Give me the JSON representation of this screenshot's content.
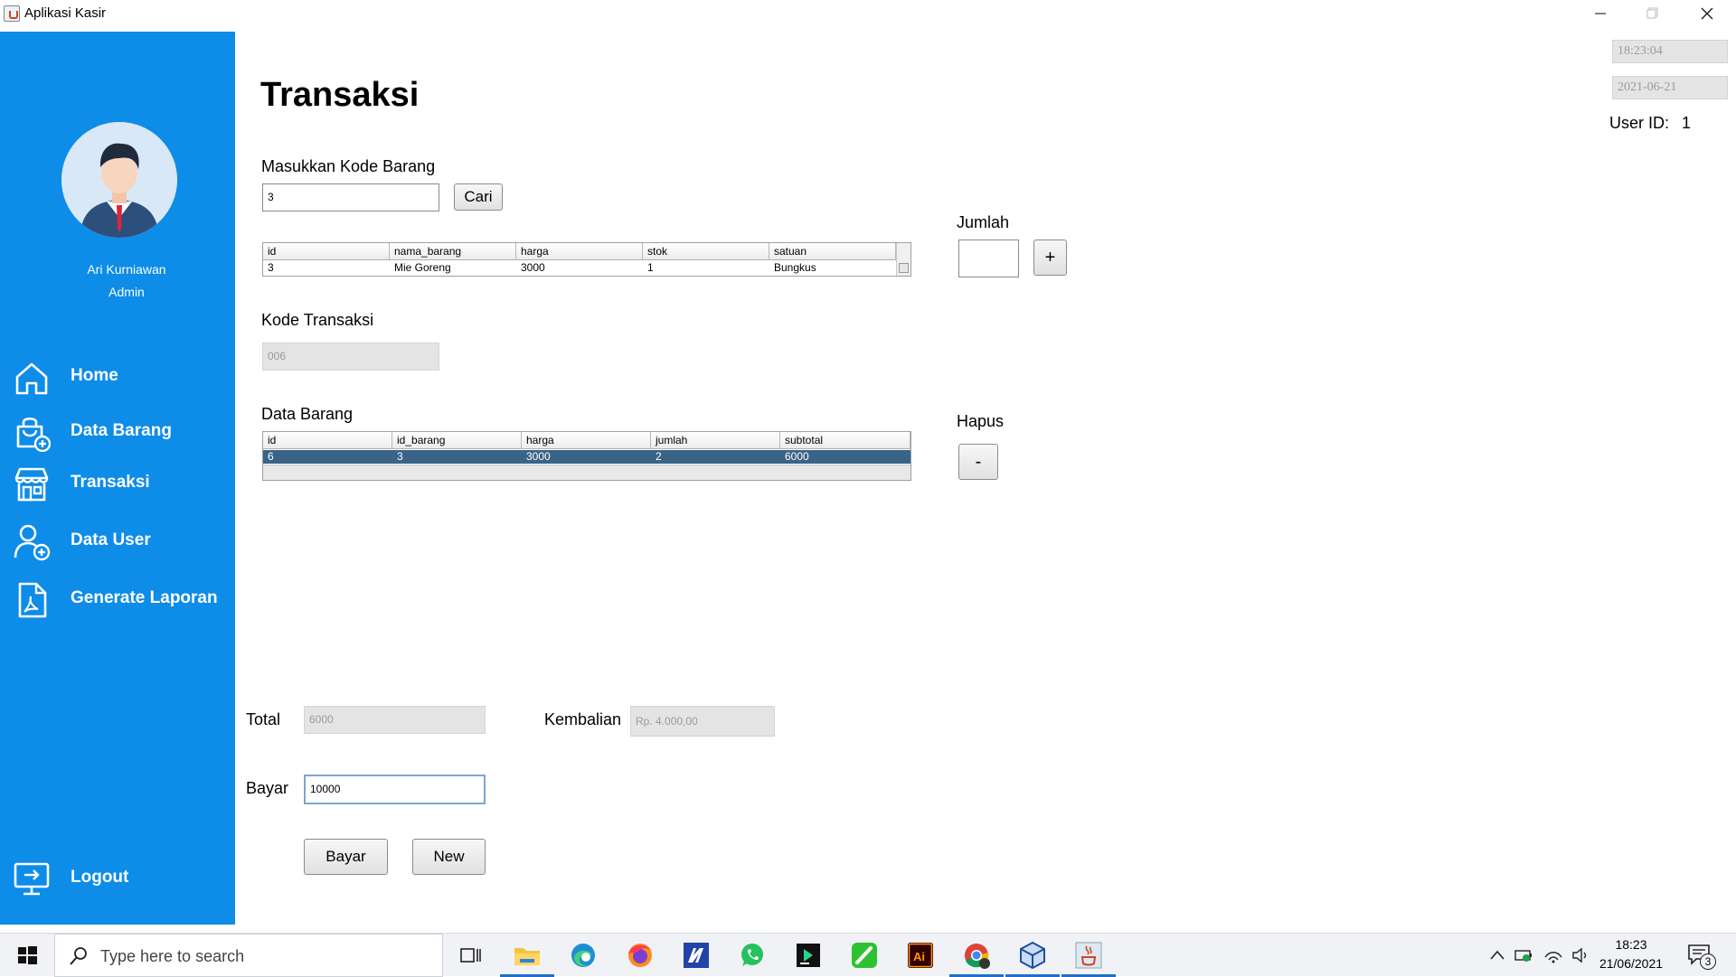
{
  "window": {
    "title": "Aplikasi Kasir"
  },
  "sidebar": {
    "user_name": "Ari Kurniawan",
    "user_role": "Admin",
    "items": [
      {
        "label": "Home",
        "icon": "home-icon"
      },
      {
        "label": "Data Barang",
        "icon": "bag-add-icon"
      },
      {
        "label": "Transaksi",
        "icon": "store-icon"
      },
      {
        "label": "Data User",
        "icon": "user-add-icon"
      },
      {
        "label": "Generate Laporan",
        "icon": "pdf-document-icon"
      }
    ],
    "logout_label": "Logout",
    "accent": "#0d8ce8"
  },
  "header": {
    "time": "18:23:04",
    "date": "2021-06-21",
    "user_id_label": "User ID:",
    "user_id_value": "1"
  },
  "main": {
    "title": "Transaksi",
    "kode_barang_label": "Masukkan Kode Barang",
    "kode_barang_value": "3",
    "cari_label": "Cari",
    "jumlah_label": "Jumlah",
    "jumlah_value": "",
    "add_label": "+",
    "search_table": {
      "columns": [
        "id",
        "nama_barang",
        "harga",
        "stok",
        "satuan"
      ],
      "rows": [
        [
          "3",
          "Mie Goreng",
          "3000",
          "1",
          "Bungkus"
        ]
      ]
    },
    "kode_transaksi_label": "Kode Transaksi",
    "kode_transaksi_value": "006",
    "data_barang_label": "Data Barang",
    "data_table": {
      "columns": [
        "id",
        "id_barang",
        "harga",
        "jumlah",
        "subtotal"
      ],
      "rows": [
        [
          "6",
          "3",
          "3000",
          "2",
          "6000"
        ]
      ]
    },
    "hapus_label": "Hapus",
    "remove_label": "-",
    "total_label": "Total",
    "total_value": "6000",
    "kembalian_label": "Kembalian",
    "kembalian_value": "Rp. 4.000,00",
    "bayar_label": "Bayar",
    "bayar_value": "10000",
    "bayar_button": "Bayar",
    "new_button": "New"
  },
  "taskbar": {
    "search_placeholder": "Type here to search",
    "time": "18:23",
    "date": "21/06/2021",
    "notification_count": "3"
  }
}
